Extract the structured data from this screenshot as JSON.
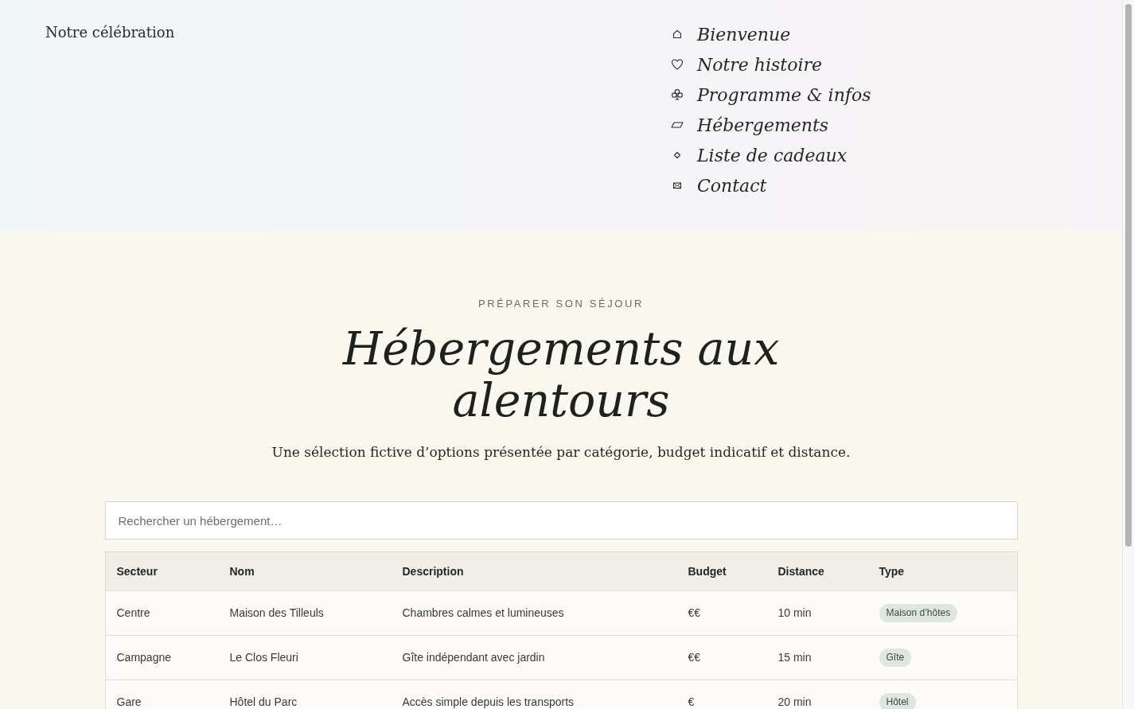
{
  "header": {
    "site_title": "Notre célébration",
    "nav": [
      "Bienvenue",
      "Notre histoire",
      "Programme & infos",
      "Hébergements",
      "Liste de cadeaux",
      "Contact"
    ]
  },
  "intro": {
    "eyebrow": "PRÉPARER SON SÉJOUR",
    "title": "Hébergements aux alentours",
    "subtitle": "Une sélection fictive d’options présentée par catégorie, budget indicatif et distance."
  },
  "search": {
    "placeholder": "Rechercher un hébergement…"
  },
  "table": {
    "columns": [
      {
        "label": "Secteur",
        "kind": "text"
      },
      {
        "label": "Nom",
        "kind": "text"
      },
      {
        "label": "Description",
        "kind": "text"
      },
      {
        "label": "Budget",
        "kind": "text"
      },
      {
        "label": "Distance",
        "kind": "text"
      },
      {
        "label": "Type",
        "kind": "tag"
      }
    ],
    "rows": [
      [
        "Centre",
        "Maison des Tilleuls",
        "Chambres calmes et lumineuses",
        "€€",
        "10 min",
        "Maison d’hôtes"
      ],
      [
        "Campagne",
        "Le Clos Fleuri",
        "Gîte indépendant avec jardin",
        "€€",
        "15 min",
        "Gîte"
      ],
      [
        "Gare",
        "Hôtel du Parc",
        "Accès simple depuis les transports",
        "€",
        "20 min",
        "Hôtel"
      ]
    ]
  }
}
